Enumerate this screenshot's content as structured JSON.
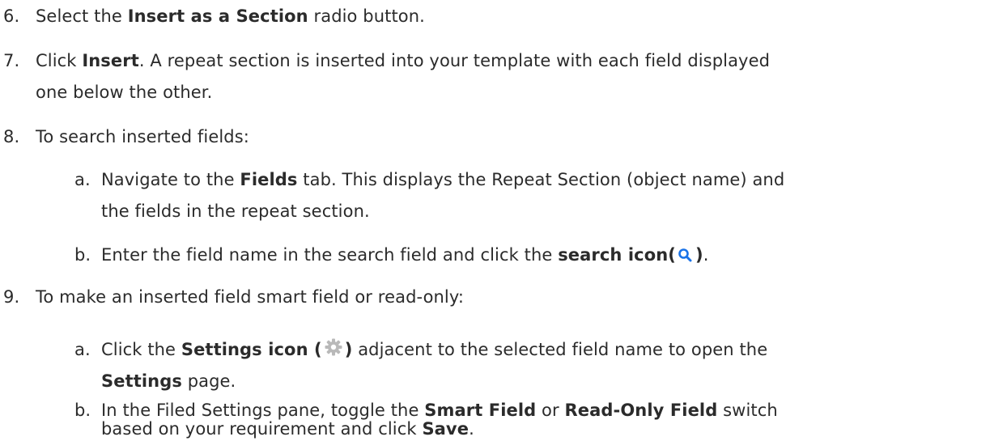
{
  "items": {
    "i6": {
      "num": "6.",
      "p1": "Select the ",
      "b1": "Insert as a Section",
      "p2": " radio button."
    },
    "i7": {
      "num": "7.",
      "p1": "Click ",
      "b1": "Insert",
      "p2": ". A repeat section is inserted into your template with each field displayed",
      "cont": "one below the other."
    },
    "i8": {
      "num": "8.",
      "text": "To search inserted fields:"
    },
    "i8a": {
      "num": "a.",
      "p1": "Navigate to the ",
      "b1": "Fields",
      "p2": " tab. This displays the Repeat Section (object name) and",
      "cont": "the fields in the repeat section."
    },
    "i8b": {
      "num": "b.",
      "p1": "Enter the field name in the search field and click the ",
      "b1": "search icon(",
      "b2": ")",
      "p2": "."
    },
    "i9": {
      "num": "9.",
      "text": "To make an inserted field smart field or read-only:"
    },
    "i9a": {
      "num": "a.",
      "p1": "Click the ",
      "b1": "Settings icon (",
      "b2": ")",
      "p2": " adjacent to the selected field name to open the",
      "cont_b": "Settings",
      "cont_p": " page."
    },
    "i9b": {
      "num": "b.",
      "p1": "In the Filed Settings pane, toggle the ",
      "b1": "Smart Field",
      "p2": " or ",
      "b2": "Read-Only Field",
      "p3": " switch",
      "cont_p1": "based on your requirement and click ",
      "cont_b": "Save",
      "cont_p2": "."
    }
  },
  "colors": {
    "text": "#2b2b2b",
    "search_icon": "#1a73e8",
    "gear_icon": "#b9b9b9"
  },
  "icons": {
    "search": "search-icon",
    "settings": "gear-icon"
  }
}
